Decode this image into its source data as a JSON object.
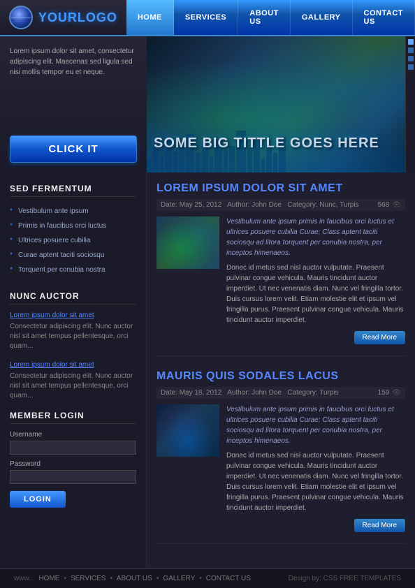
{
  "header": {
    "logo_text": "YOURLOGO",
    "nav": [
      {
        "label": "HOME",
        "active": true
      },
      {
        "label": "SERVICES",
        "active": false
      },
      {
        "label": "ABOUT US",
        "active": false
      },
      {
        "label": "GALLERY",
        "active": false
      },
      {
        "label": "CONTACT US",
        "active": false
      }
    ]
  },
  "hero": {
    "left_text": "Lorem ipsum dolor sit amet, consectetur adipiscing elit. Maecenas sed ligula sed nisi mollis tempor eu et neque.",
    "button_label": "CLICK IT",
    "title": "SOME BIG TITTLE GOES HERE"
  },
  "sidebar": {
    "section1_title": "SED FERMENTUM",
    "links": [
      "Vestibulum ante ipsum",
      "Primis in faucibus orci luctus",
      "Ultrices posuere cubilia",
      "Curae aptent taciti sociosqu",
      "Torquent per conubia nostra"
    ],
    "section2_title": "NUNC AUCTOR",
    "posts": [
      {
        "link": "Lorem ipsum dolor sit amet",
        "desc": "Consectetur adipiscing elit. Nunc auctor nisl sit amet tempus pellentesque, orci quam..."
      },
      {
        "link": "Lorem ipsum dolor sit amet",
        "desc": "Consectetur adipiscing elit. Nunc auctor nisl sit amet tempus pellentesque, orci quam..."
      }
    ],
    "member_login": {
      "title": "MEMBER LOGIN",
      "username_label": "Username",
      "password_label": "Password",
      "button_label": "LOGIN"
    }
  },
  "content": {
    "posts": [
      {
        "title": "LOREM IPSUM DOLOR SIT AMET",
        "date": "May 25, 2012",
        "author": "John Doe",
        "category": "Nunc, Turpis",
        "views": "568",
        "intro": "Vestibulum ante ipsum primis in faucibus orci luctus et ultrices posuere cubilia Curae; Class aptent taciti sociosqu ad litora torquent per conubia nostra, per inceptos himenaeos.",
        "body": "Donec id metus sed nisl auctor vulputate. Praesent pulvinar congue vehicula. Mauris tincidunt auctor imperdiet. Ut nec venenatis diam. Nunc vel fringilla tortor. Duis cursus lorem velit. Etiam molestie elit et ipsum vel fringilla purus. Praesent pulvinar congue vehicula. Mauris tincidunt auctor imperdiet.",
        "read_more": "Read More"
      },
      {
        "title": "MAURIS QUIS SODALES LACUS",
        "date": "May 18, 2012",
        "author": "John Doe",
        "category": "Turpis",
        "views": "159",
        "intro": "Vestibulum ante ipsum primis in faucibus orci luctus et ultrices posuere cubilia Curae; Class aptent taciti sociosqu ad litora torquent per conubia nostra, per inceptos himenaeos.",
        "body": "Donec id metus sed nisl auctor vulputate. Praesent pulvinar congue vehicula. Mauris tincidunt auctor imperdiet. Ut nec venenatis diam. Nunc vel fringilla tortor. Duis cursus lorem velit. Etiam molestie elit et ipsum vel fringilla purus. Praesent pulvinar congue vehicula. Mauris tincidunt auctor imperdiet.",
        "read_more": "Read More"
      }
    ]
  },
  "footer": {
    "links": [
      "HOME",
      "SERVICES",
      "ABOUT US",
      "GALLERY",
      "CONTACT US"
    ],
    "credit": "Design by: CSS FREE TEMPLATES",
    "url": "www..."
  }
}
